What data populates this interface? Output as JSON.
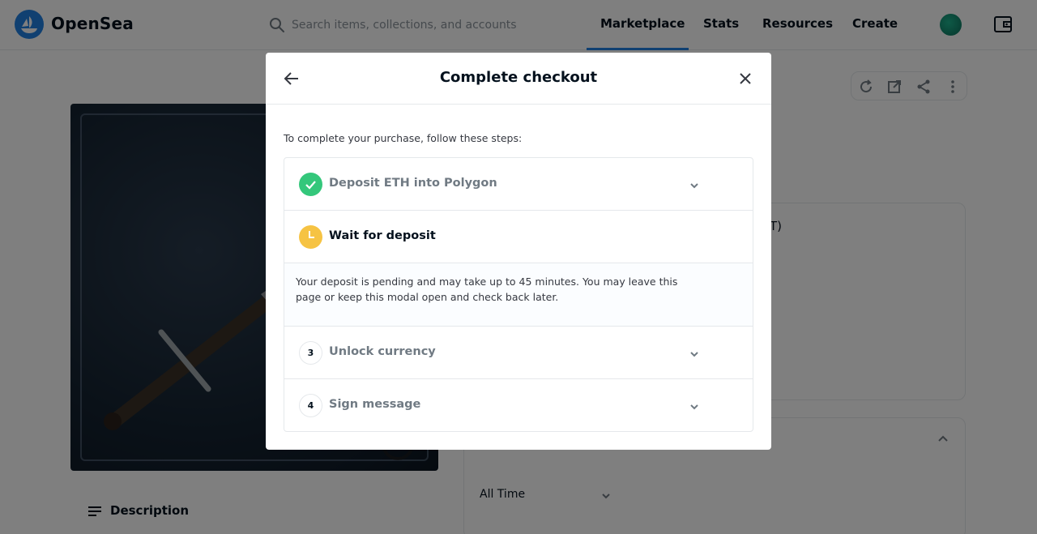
{
  "navbar": {
    "brand": "OpenSea",
    "search_placeholder": "Search items, collections, and accounts",
    "links": [
      "Marketplace",
      "Stats",
      "Resources",
      "Create"
    ],
    "active_link": "Marketplace"
  },
  "background": {
    "partial_text": "CST)",
    "time_filter": "All Time",
    "description_label": "Description"
  },
  "modal": {
    "title": "Complete checkout",
    "intro": "To complete your purchase, follow these steps:",
    "steps": [
      {
        "number": "",
        "label": "Deposit ETH into Polygon",
        "status": "complete"
      },
      {
        "number": "",
        "label": "Wait for deposit",
        "status": "in-progress"
      },
      {
        "number": "3",
        "label": "Unlock currency",
        "status": "pending"
      },
      {
        "number": "4",
        "label": "Sign message",
        "status": "pending"
      }
    ],
    "active_step_detail": "Your deposit is pending and may take up to 45 minutes. You may leave this page or keep this modal open and check back later."
  },
  "colors": {
    "brand_blue": "#2081e2",
    "success_green": "#34c77b",
    "waiting_yellow": "#f6c343"
  }
}
